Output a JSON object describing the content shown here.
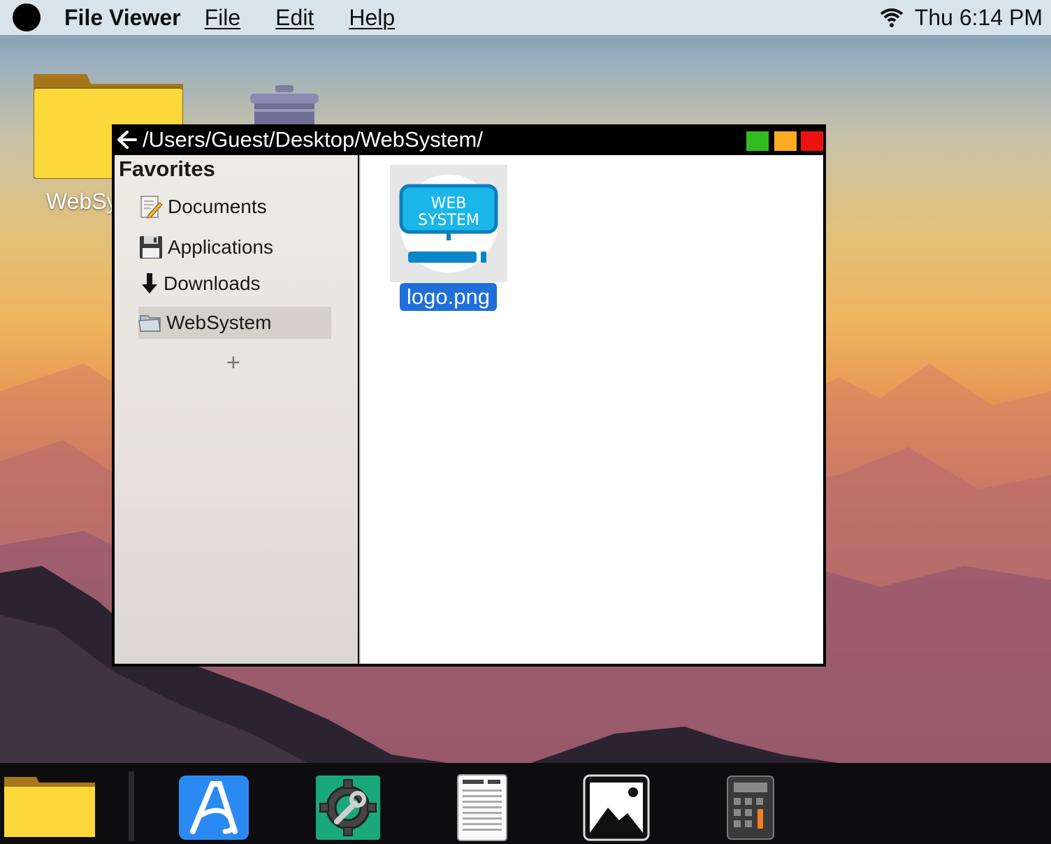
{
  "menubar": {
    "app_title": "File Viewer",
    "menus": [
      "File",
      "Edit",
      "Help"
    ],
    "clock": "Thu 6:14 PM",
    "wifi_icon": "wifi-icon"
  },
  "desktop": {
    "folder_label": "WebSy",
    "icons": [
      "folder-icon",
      "trash-icon"
    ]
  },
  "window": {
    "path": "/Users/Guest/Desktop/WebSystem/",
    "button_colors": {
      "maximize": "#33bb22",
      "minimize": "#ffaa22",
      "close": "#ee1111"
    },
    "sidebar": {
      "title": "Favorites",
      "items": [
        {
          "label": "Documents",
          "icon": "document-icon"
        },
        {
          "label": "Applications",
          "icon": "floppy-disk-icon"
        },
        {
          "label": "Downloads",
          "icon": "download-arrow-icon"
        },
        {
          "label": "WebSystem",
          "icon": "folder-icon",
          "selected": true
        }
      ],
      "add_label": "+"
    },
    "files": [
      {
        "name": "logo.png",
        "thumbnail_text": [
          "WEB",
          "SYSTEM"
        ],
        "selected": true
      }
    ]
  },
  "dock": {
    "items": [
      "folder-icon",
      "text-editor-icon",
      "settings-icon",
      "document-icon",
      "image-viewer-icon",
      "calculator-icon"
    ]
  }
}
